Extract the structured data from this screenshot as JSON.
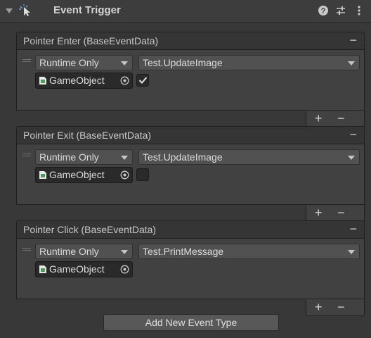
{
  "component": {
    "title": "Event Trigger",
    "header_icons": [
      "help-icon",
      "preset-sliders-icon",
      "kebab-menu-icon"
    ]
  },
  "events": [
    {
      "title": "Pointer Enter (BaseEventData)",
      "remove_label": "−",
      "call_state": "Runtime Only",
      "function": "Test.UpdateImage",
      "target": "GameObject",
      "checked": true
    },
    {
      "title": "Pointer Exit (BaseEventData)",
      "remove_label": "−",
      "call_state": "Runtime Only",
      "function": "Test.UpdateImage",
      "target": "GameObject",
      "checked": false
    },
    {
      "title": "Pointer Click (BaseEventData)",
      "remove_label": "−",
      "call_state": "Runtime Only",
      "function": "Test.PrintMessage",
      "target": "GameObject",
      "checked": null
    }
  ],
  "list_footer": {
    "add_label": "+",
    "remove_label": "−"
  },
  "add_event_button": "Add New Event Type"
}
